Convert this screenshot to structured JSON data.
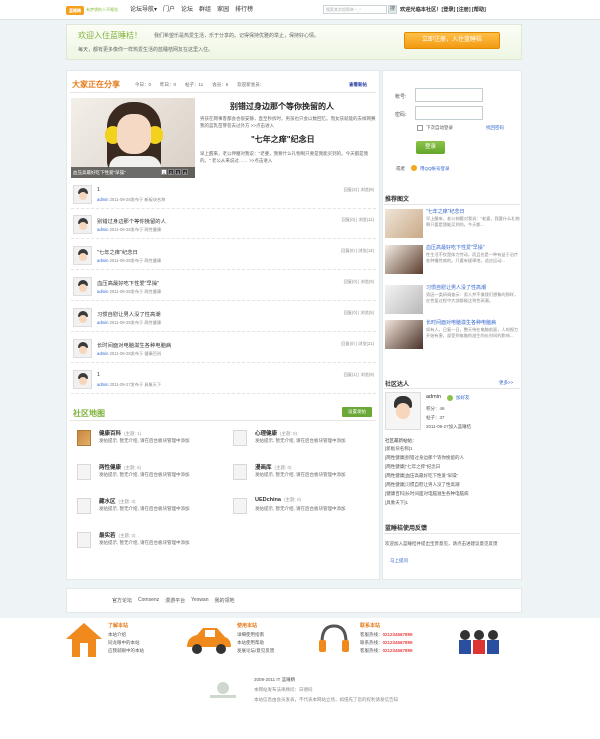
{
  "topbar": {
    "logo_label": "蓝睡精",
    "logo_slogan": "有梦想的人不睡觉",
    "nav": [
      "论坛导航▾",
      "门户",
      "论坛",
      "群组",
      "家园",
      "排行榜"
    ],
    "search_placeholder": "搜索其实很简单 ^_^",
    "search_button": "搜",
    "user_area": "欢迎光临本社区！[登录] [注册] [帮助]"
  },
  "banner": {
    "title": "欢迎入住蓝睡桔！",
    "desc_line1": "我们希望乐是热爱生活，乐于分享的。记得保持优雅的举止，保持好心情。",
    "desc_line2": "每天，都有更多像你一样热爱生活的蓝睡桔网友在这里入住。",
    "join_button": "立即注册，入住蓝睡桔"
  },
  "share": {
    "title": "大家正在分享",
    "stats": [
      "今日：0",
      "昨日：0",
      "帖子：11",
      "会员：6",
      "欢迎新会员："
    ],
    "view_new": "查看新帖",
    "photo_caption": "血压高最好吃下性爱\"早操\"",
    "pager": [
      "1",
      "2",
      "3",
      "4"
    ],
    "article1_title": "别错过身边那个等你挽留的人",
    "article1_desc": "男孩在网事客都会也很安静，直至秒拆时，男孩也只会以数回忆。而女孩就能的去样网赛我的蓝乳苗芽苞去过外方 >>点击进入",
    "article2_title": "\"七年之痒\"纪念日",
    "article2_desc": "早上醒来，老公伸腰对我说：\"老婆，我要什么礼物啊只要是我能买到的。今天都是我的。\" 老公从来说过…… >>点击进入"
  },
  "posts": [
    {
      "title": "1",
      "author": "admin",
      "meta": "2011-09-28发布于 新板块名称",
      "stats": "回复(2) | 浏览(8)"
    },
    {
      "title": "别错过身边那个等你挽留的人",
      "author": "admin",
      "meta": "2011-09-28发布于 两性健康",
      "stats": "回复(0) | 浏览(11)"
    },
    {
      "title": "\"七年之痒\"纪念日",
      "author": "admin",
      "meta": "2011-09-28发布于 两性健康",
      "stats": "回复(0) | 浏览(14)"
    },
    {
      "title": "血压高最好吃下性爱\"早操\"",
      "author": "admin",
      "meta": "2011-09-28发布于 两性健康",
      "stats": "回复(0) | 浏览(9)"
    },
    {
      "title": "习惯自慰让男人没了性高潮",
      "author": "admin",
      "meta": "2011-09-28发布于 两性健康",
      "stats": "回复(0) | 浏览(5)"
    },
    {
      "title": "长时间面对电脑滋生各种电脑病",
      "author": "admin",
      "meta": "2011-09-28发布于 健康百科",
      "stats": "回复(0) | 浏览(21)"
    },
    {
      "title": "1",
      "author": "admin",
      "meta": "2011-09-27发布于 具象天下",
      "stats": "回复(1) | 浏览(9)"
    }
  ],
  "forum_map": {
    "title": "社区地图",
    "button": "设置发帖",
    "forums": [
      {
        "name": "健康百科",
        "topics": "(主题: 1)",
        "desc": "发帖提示, 暂无介绍, 请在后台板块管理中添加"
      },
      {
        "name": "心理健康",
        "topics": "(主题: 0)",
        "desc": "发帖提示, 暂无介绍, 请在后台板块管理中添加"
      },
      {
        "name": "两性健康",
        "topics": "(主题: 5)",
        "desc": "发帖提示, 暂无介绍, 请在后台板块管理中添加"
      },
      {
        "name": "漫画库",
        "topics": "(主题: 0)",
        "desc": "发帖提示, 暂无介绍, 请在后台板块管理中添加"
      },
      {
        "name": "藏水区",
        "topics": "(主题: 0)",
        "desc": "发帖提示, 暂无介绍, 请在后台板块管理中添加"
      },
      {
        "name": "UEDchina",
        "topics": "(主题: 0)",
        "desc": "发帖提示, 暂无介绍, 请在后台板块管理中添加"
      },
      {
        "name": "最实若",
        "topics": "(主题: 0)",
        "desc": "发帖提示, 暂无介绍, 请在后台板块管理中添加"
      }
    ]
  },
  "login": {
    "username_label": "帐号:",
    "password_label": "密码:",
    "remember": "下次自动登录",
    "forgot": "找回密码",
    "login_button": "登录",
    "qq_prefix": "或者",
    "qq_link": "用QQ帐号登录"
  },
  "recommend": {
    "title": "推荐图文",
    "items": [
      {
        "title": "\"七年之痒\"纪念日",
        "desc": "早上醒来，老公伸腰对我说：\"老婆，我要什么礼物啊只要是我能买到的。今天都..."
      },
      {
        "title": "血压高最好吃下性爱\"早操\"",
        "desc": "性生活不仅是体力劳动，而且也是一种有益于治疗各种慢性病的。只要有规律地，适应运动..."
      },
      {
        "title": "习惯自慰让男人没了性高潮",
        "desc": "男因一类研调查示：男人并不像我们想象的那样，在性爱过程中大部都能达到性高潮。"
      },
      {
        "title": "长时间面对电脑滋生各种电脑病",
        "desc": "如有人，日复一日，整天待在电脑前面，人的视力开始有害，部受到电脑的滋生的长时间的影响..."
      }
    ]
  },
  "talent": {
    "title": "社区达人",
    "more": "更多>>",
    "name": "admin",
    "add_friend": "加好友",
    "points": "积分：46",
    "posts": "帖子：37",
    "joined": "2011-09-27加入蓝睡桔",
    "recent_title": "社区最新帖帖：",
    "recent": [
      "[新板块名称]1",
      "[两性健康]别错过身边那个等你挽留的人",
      "[两性健康]\"七年之痒\"纪念日",
      "[两性健康]血压高最好吃下性爱\"早操\"",
      "[两性健康]习惯自慰让男人没了性高潮",
      "[健康百科]长时间面对电脑滋生各种电脑病",
      "[具象天下]1"
    ]
  },
  "feedback": {
    "title": "蓝睡桔使用反馈",
    "desc": "欢迎加入蓝睡桔并提出宝贵意见，请点击进建议意见反馈",
    "link": "马上提问"
  },
  "footer": {
    "links": [
      "官方论坛",
      "Comsenz",
      "漫游平台",
      "Yeswan",
      "我的领地"
    ],
    "col1": {
      "title": "了解本站",
      "lines": [
        "本站介绍",
        "同龙眼中的本站",
        "应我就眼中的本站"
      ]
    },
    "col2": {
      "title": "使用本站",
      "lines": [
        "详细使用指南",
        "本站使用帮助",
        "发展论坛/意见反馈"
      ]
    },
    "col3": {
      "title": "联系本站",
      "lines": [
        "客服热线：",
        "联系热线：",
        "客服热线："
      ],
      "phone": "021234567899"
    },
    "copyright1": "2009-2011  IT 蓝睡精",
    "copyright2": "本网站发布法律顾问：日德码",
    "copyright3": "本站信息由会员发表，不代表本网站立场，如侵先了您的权利请发信告知"
  },
  "colors": {
    "accent": "#e77a1a",
    "green": "#7fb23a",
    "link": "#3366cc"
  }
}
